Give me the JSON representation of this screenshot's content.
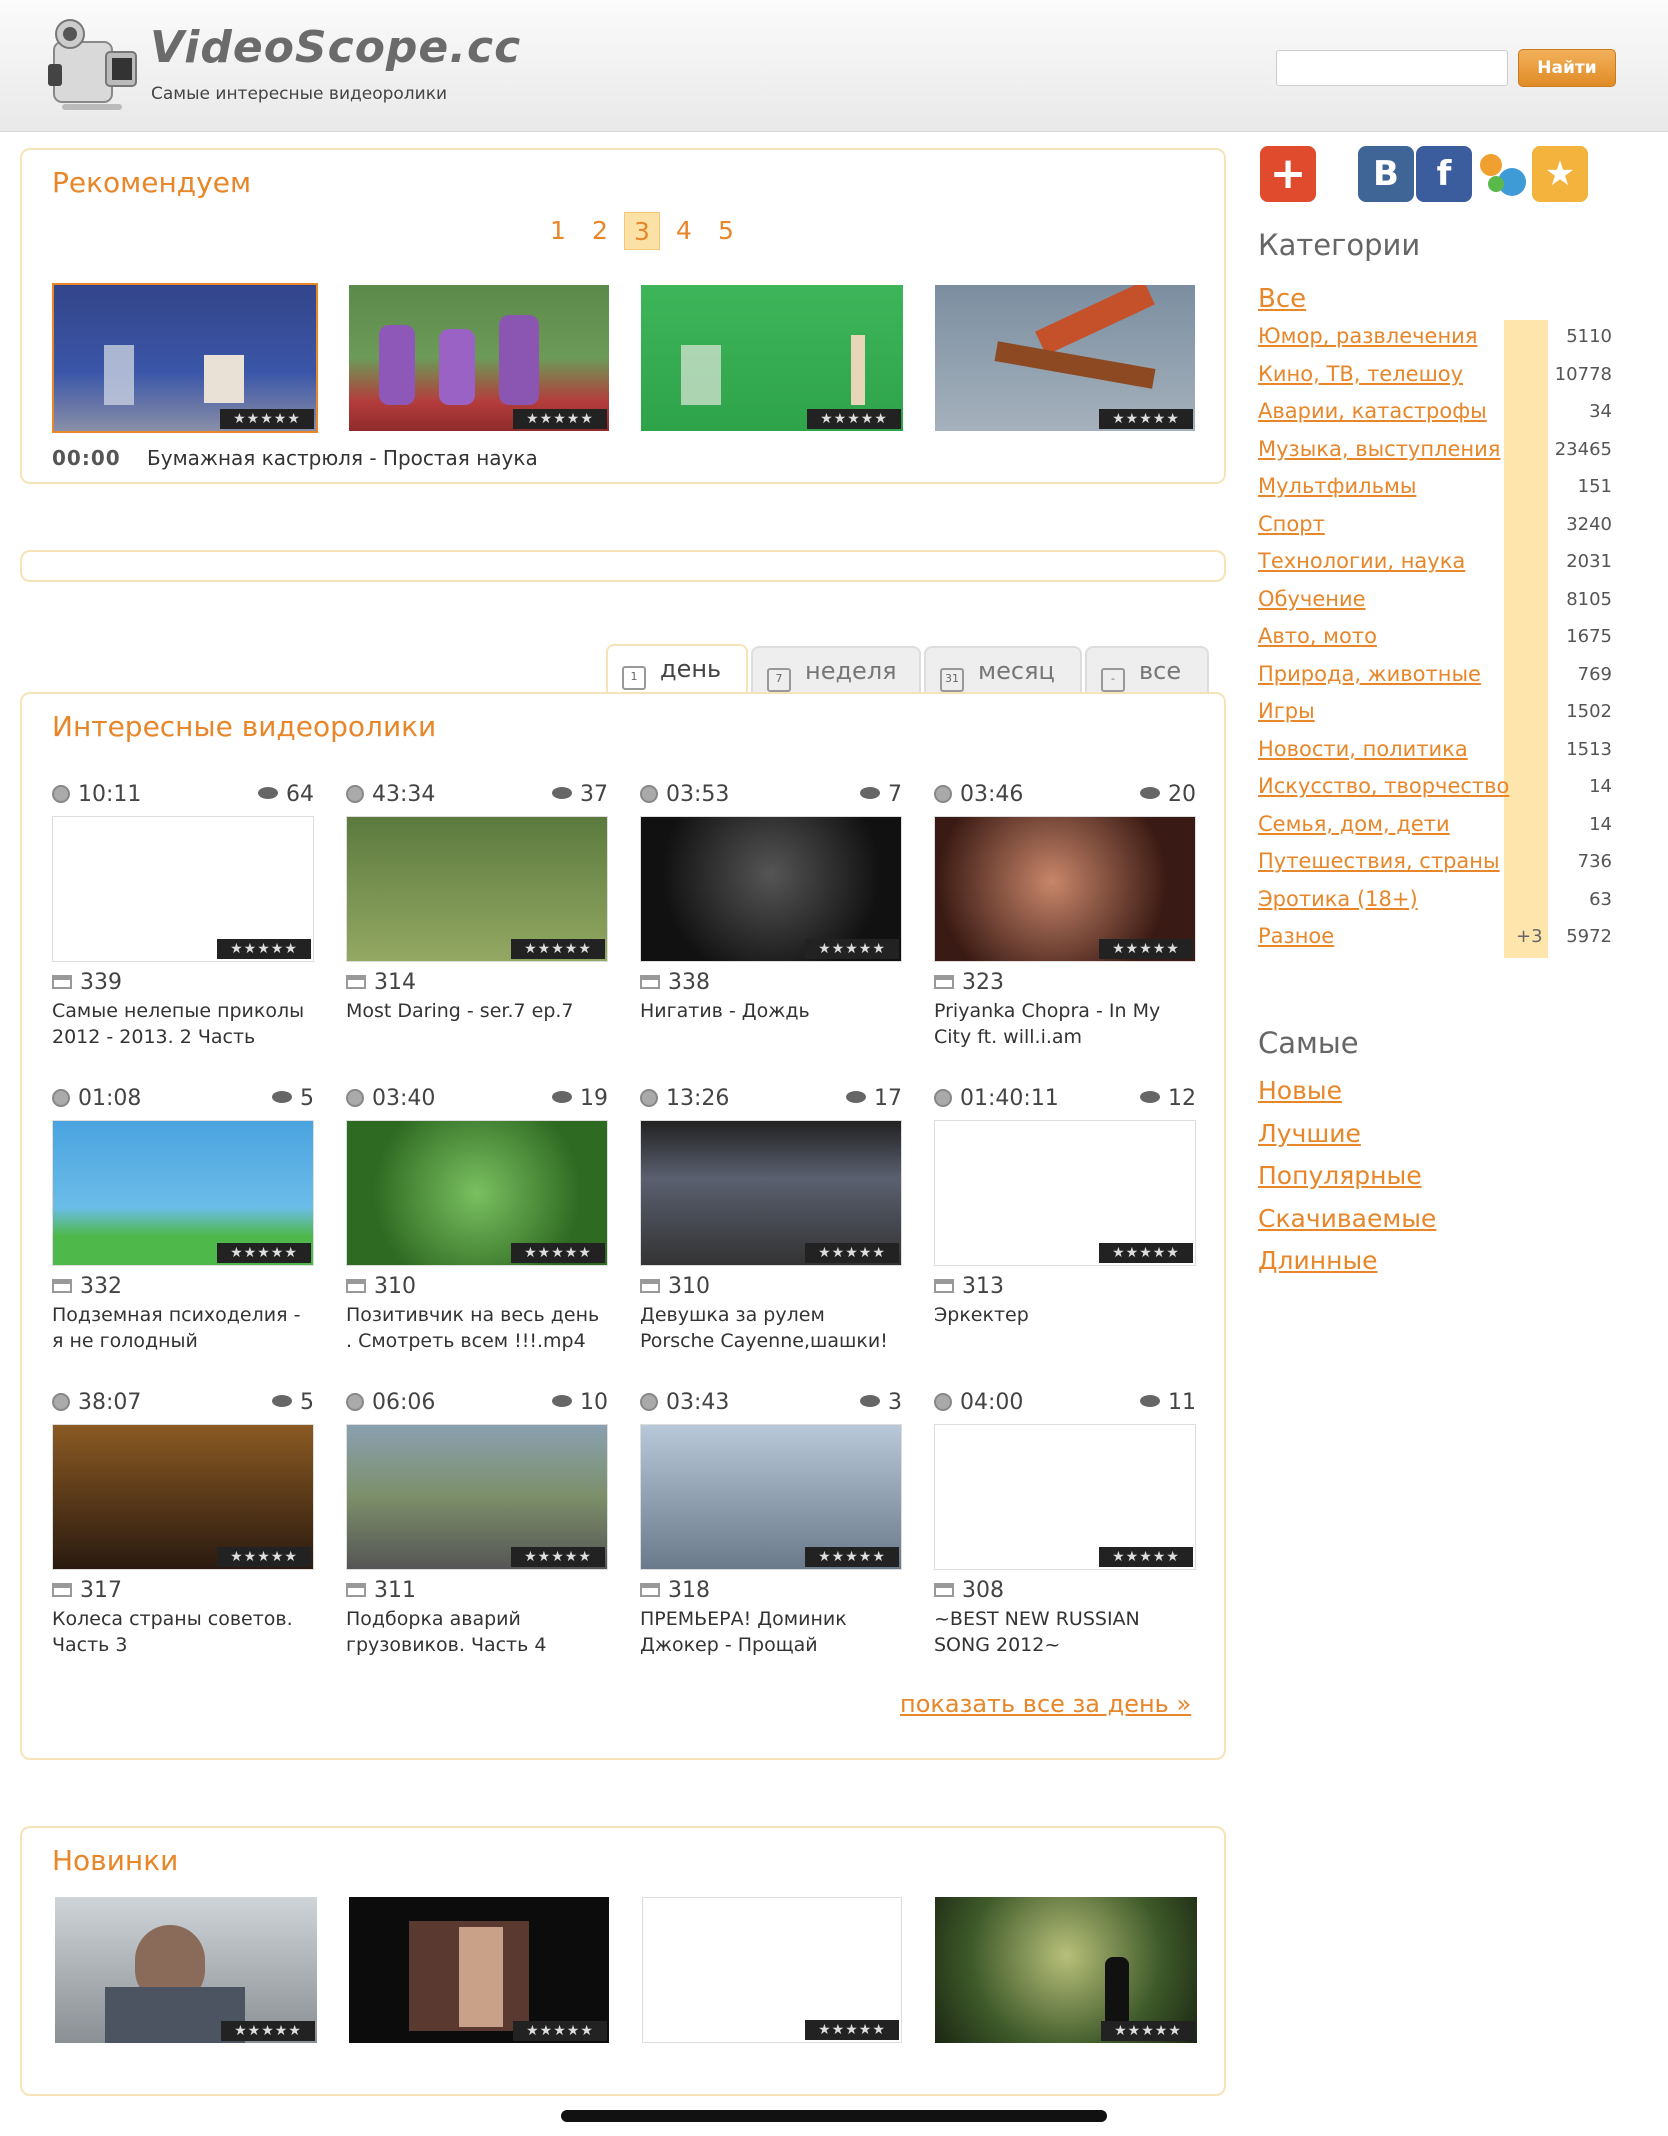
{
  "header": {
    "site_name": "VideoScope.cc",
    "tagline": "Самые интересные видеоролики",
    "search_placeholder": "",
    "search_button": "Найти"
  },
  "recommend": {
    "title": "Рекомендуем",
    "pages": [
      "1",
      "2",
      "3",
      "4",
      "5"
    ],
    "active_page": "3",
    "caption_time": "00:00",
    "caption_title": "Бумажная кастрюля - Простая наука"
  },
  "tabs": {
    "day": "день",
    "week": "неделя",
    "month": "месяц",
    "all": "все",
    "day_icon": "1",
    "week_icon": "7",
    "month_icon": "31",
    "all_icon": "-"
  },
  "interesting": {
    "title": "Интересные видеоролики",
    "videos": [
      {
        "duration": "10:11",
        "views": "64",
        "count": "339",
        "title": "Самые нелепые приколы 2012 - 2013. 2 Часть"
      },
      {
        "duration": "43:34",
        "views": "37",
        "count": "314",
        "title": "Most Daring - ser.7 ep.7"
      },
      {
        "duration": "03:53",
        "views": "7",
        "count": "338",
        "title": "Нигатив - Дождь"
      },
      {
        "duration": "03:46",
        "views": "20",
        "count": "323",
        "title": "Priyanka Chopra - In My City ft. will.i.am"
      },
      {
        "duration": "01:08",
        "views": "5",
        "count": "332",
        "title": "Подземная психоделия - я не голодный"
      },
      {
        "duration": "03:40",
        "views": "19",
        "count": "310",
        "title": "Позитивчик на весь день . Смотреть всем !!!.mp4"
      },
      {
        "duration": "13:26",
        "views": "17",
        "count": "310",
        "title": "Девушка за рулем Porsche Cayenne,шашки!"
      },
      {
        "duration": "01:40:11",
        "views": "12",
        "count": "313",
        "title": "Эркектер"
      },
      {
        "duration": "38:07",
        "views": "5",
        "count": "317",
        "title": "Колеса страны советов. Часть 3"
      },
      {
        "duration": "06:06",
        "views": "10",
        "count": "311",
        "title": "Подборка аварий грузовиков. Часть 4"
      },
      {
        "duration": "03:43",
        "views": "3",
        "count": "318",
        "title": "ПРЕМЬЕРА! Доминик Джокер - Прощай"
      },
      {
        "duration": "04:00",
        "views": "11",
        "count": "308",
        "title": "~BEST NEW RUSSIAN SONG 2012~"
      }
    ],
    "show_all": "показать все за день »"
  },
  "new": {
    "title": "Новинки"
  },
  "sidebar": {
    "categories_title": "Категории",
    "all_label": "Все",
    "categories": [
      {
        "name": "Юмор, развлечения",
        "count": "5110"
      },
      {
        "name": "Кино, ТВ, телешоу",
        "count": "10778"
      },
      {
        "name": "Аварии, катастрофы",
        "count": "34"
      },
      {
        "name": "Музыка, выступления",
        "count": "23465"
      },
      {
        "name": "Мультфильмы",
        "count": "151"
      },
      {
        "name": "Спорт",
        "count": "3240"
      },
      {
        "name": "Технологии, наука",
        "count": "2031"
      },
      {
        "name": "Обучение",
        "count": "8105"
      },
      {
        "name": "Авто, мото",
        "count": "1675"
      },
      {
        "name": "Природа, животные",
        "count": "769"
      },
      {
        "name": "Игры",
        "count": "1502"
      },
      {
        "name": "Новости, политика",
        "count": "1513"
      },
      {
        "name": "Искусство, творчество",
        "count": "14"
      },
      {
        "name": "Семья, дом, дети",
        "count": "14"
      },
      {
        "name": "Путешествия, страны",
        "count": "736"
      },
      {
        "name": "Эротика (18+)",
        "count": "63"
      },
      {
        "name": "Разное",
        "count": "5972",
        "extra": "+3"
      }
    ],
    "best_title": "Самые",
    "best": [
      "Новые",
      "Лучшие",
      "Популярные",
      "Скачиваемые",
      "Длинные"
    ],
    "share": {
      "add": "+",
      "vk": "В",
      "fb": "f",
      "star": "★"
    }
  },
  "stars_glyph": "★★★★★",
  "colors": {
    "accent": "#e8862a",
    "border": "#f6e4b8",
    "bar": "#fde5ac"
  }
}
